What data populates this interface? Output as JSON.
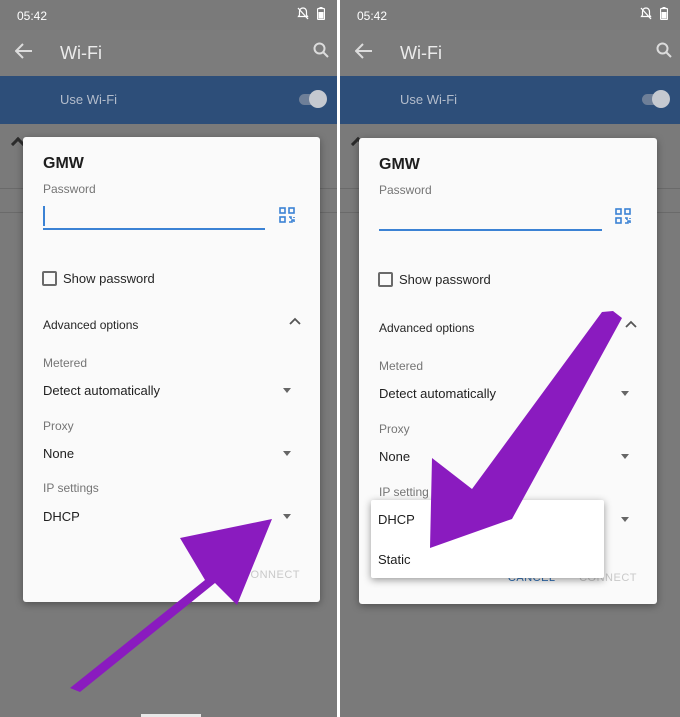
{
  "status": {
    "time": "05:42"
  },
  "appbar": {
    "title": "Wi-Fi"
  },
  "use_wifi": {
    "label": "Use Wi-Fi"
  },
  "dialog": {
    "network": "GMW",
    "password_label": "Password",
    "show_password": "Show password",
    "advanced_options": "Advanced options",
    "metered_label": "Metered",
    "metered_value": "Detect automatically",
    "proxy_label": "Proxy",
    "proxy_value": "None",
    "ip_label": "IP settings",
    "ip_label_truncated": "IP setting",
    "ip_value": "DHCP",
    "connect_truncated": "ONNECT",
    "cancel": "CANCEL",
    "connect": "CONNECT"
  },
  "ip_menu": {
    "options": [
      "DHCP",
      "Static"
    ]
  },
  "colors": {
    "arrow": "#8a1bbf",
    "accent": "#3b82d4",
    "wifi_bar": "#2d4e79"
  }
}
